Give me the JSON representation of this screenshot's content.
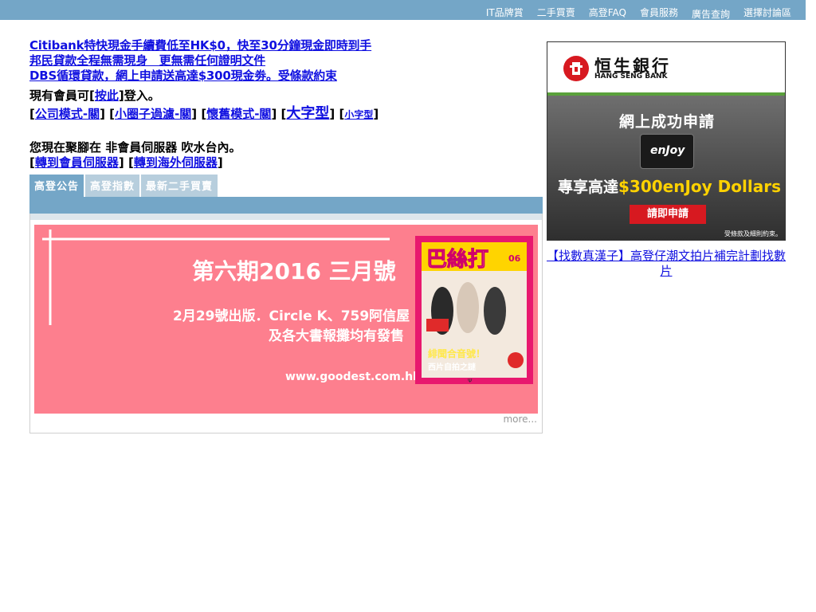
{
  "topnav": [
    {
      "label": "IT品牌賞"
    },
    {
      "label": "二手買賣"
    },
    {
      "label": "高登FAQ"
    },
    {
      "label": "會員服務"
    },
    {
      "label": "廣告查詢"
    },
    {
      "label": "選擇討論區"
    }
  ],
  "ads": [
    "Citibank特快現金手續費低至HK$0，快至30分鐘現金即時到手",
    "邦民貸款全程無需現身　更無需任何證明文件",
    "DBS循環貸款，網上申請送高達$300現金劵。受條款約束"
  ],
  "login": {
    "prefix": "現有會員可[",
    "link": "按此",
    "suffix": "]登入。"
  },
  "modes": [
    {
      "label": "公司模式-關"
    },
    {
      "label": "小圈子過濾-關"
    },
    {
      "label": "懷舊模式-關"
    },
    {
      "label": "大字型"
    },
    {
      "label": "小字型"
    }
  ],
  "server": {
    "status": "您現在聚腳在 非會員伺服器 吹水台內。",
    "link_member": "轉到會員伺服器",
    "link_overseas": "轉到海外伺服器"
  },
  "tabs": [
    {
      "label": "高登公告",
      "active": true
    },
    {
      "label": "高登指數",
      "active": false
    },
    {
      "label": "最新二手買賣",
      "active": false
    }
  ],
  "banner": {
    "headline": "第六期2016 三月號",
    "line1": "2月29號出版．Circle K、759阿信屋",
    "line2": "及各大書報攤均有發售",
    "url": "www.goodest.com.hk",
    "magazine_title": "巴絲打",
    "magazine_issue": "06",
    "magazine_caption": "緋聞合音號！",
    "magazine_caption2": "西片自拍之謎",
    "magazine_tag": "Ψ"
  },
  "more_label": "more...",
  "bank_ad": {
    "name_zh": "恒生銀行",
    "name_en": "HANG SENG BANK",
    "headline": "網上成功申請",
    "card_brand": "enJoy",
    "offer_prefix": "專享高達",
    "offer_highlight": "$300enJoy Dollars",
    "button": "請即申請",
    "fine_print": "受條款及細則約束。"
  },
  "promo_link": "【找數真漢子】高登仔潮文拍片補完計劃找數片",
  "colors": {
    "topbar": "#74a6c7",
    "tab_inactive": "#b7cedd",
    "link": "#1010e0",
    "banner_bg": "#fd7f8e",
    "bank_red": "#d71920",
    "bank_green": "#5aa13b",
    "offer_yellow": "#ffd200"
  }
}
